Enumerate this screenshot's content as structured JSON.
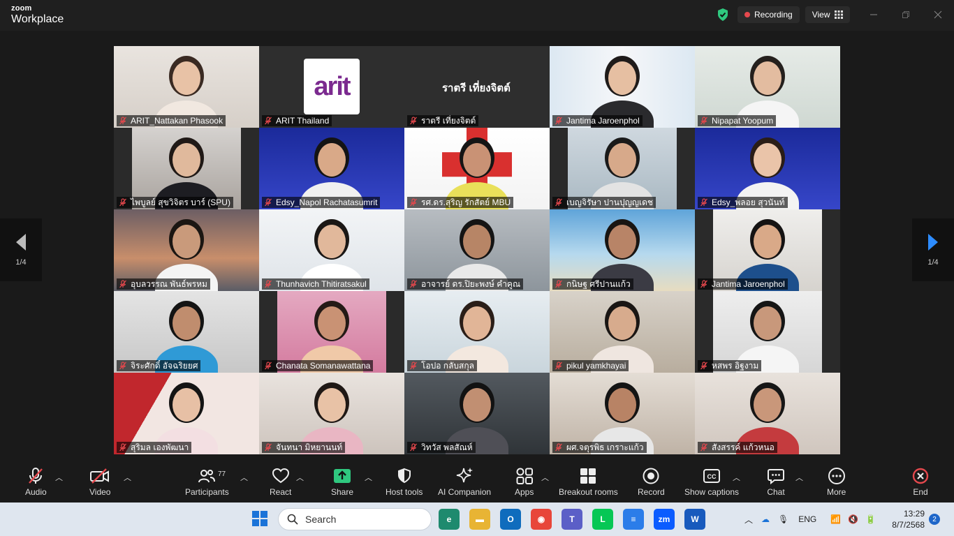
{
  "app": {
    "brand_line1": "zoom",
    "brand_line2": "Workplace"
  },
  "topbar": {
    "recording_label": "Recording",
    "view_label": "View"
  },
  "pager": {
    "left_count": "1/4",
    "right_count": "1/4"
  },
  "center_name_large": "ราตรี เที่ยงจิตต์",
  "arit_logo_text": "arit",
  "participants": [
    {
      "name": "ARIT_Nattakan Phasook"
    },
    {
      "name": "ARIT Thailand"
    },
    {
      "name": "ราตรี เที่ยงจิตต์"
    },
    {
      "name": "Jantima Jaroenphol"
    },
    {
      "name": "Nipapat  Yoopum"
    },
    {
      "name": "ไพบูลย์ สุขวิจิตร บาร์ (SPU)"
    },
    {
      "name": "Edsy_Napol Rachatasumrit"
    },
    {
      "name": "รศ.ดร.สุริญ รักสัตย์ MBU"
    },
    {
      "name": "เบญจิรัษา ปานปุญญเดช"
    },
    {
      "name": "Edsy_พลอย สุวนันท์"
    },
    {
      "name": "อุบลวรรณ พันธ์พรหม"
    },
    {
      "name": "Thunhavich Thitiratsakul"
    },
    {
      "name": "อาจารย์ ดร.ปิยะพงษ์ คำคูณ"
    },
    {
      "name": "กนิษฐ ศรีปานแก้ว"
    },
    {
      "name": "Jantima Jaroenphol"
    },
    {
      "name": "จิระศักดิ์ อัจฉริยยศ"
    },
    {
      "name": "Chanata Somanawattana"
    },
    {
      "name": "โอปอ  กลับสกุล"
    },
    {
      "name": "pikul yamkhayai"
    },
    {
      "name": "หสพร อิฐงาม"
    },
    {
      "name": "สุริมล เองพัฒนา"
    },
    {
      "name": "จันทนา มิหยานนท์"
    },
    {
      "name": "วิทวัส พลสัณห์"
    },
    {
      "name": "ผศ.จตุรพิธ เกราะแก้ว"
    },
    {
      "name": "สังสรรค์ แก้วหนอ"
    }
  ],
  "toolbar": {
    "audio": "Audio",
    "video": "Video",
    "participants": "Participants",
    "participants_count": "77",
    "react": "React",
    "share": "Share",
    "host_tools": "Host tools",
    "ai_companion": "AI Companion",
    "apps": "Apps",
    "breakout_rooms": "Breakout rooms",
    "record": "Record",
    "show_captions": "Show captions",
    "chat": "Chat",
    "more": "More",
    "end": "End"
  },
  "taskbar": {
    "search_placeholder": "Search",
    "lang": "ENG",
    "time": "13:29",
    "date": "8/7/2568",
    "notification_count": "2"
  },
  "colors": {
    "active_speaker": "#2fc87f",
    "end_red": "#e5484d",
    "share_green": "#2fc87f"
  }
}
